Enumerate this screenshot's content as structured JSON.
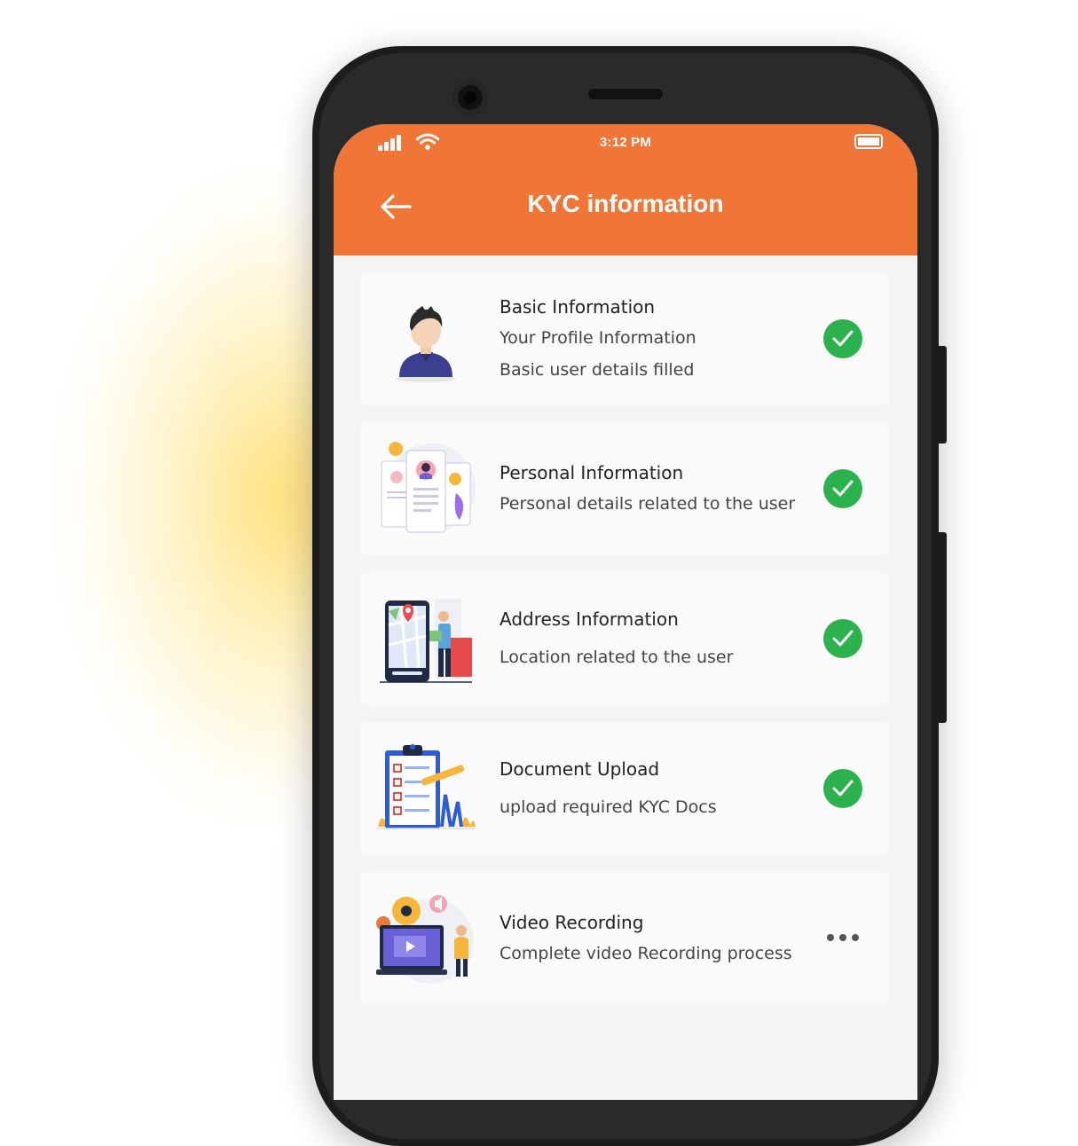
{
  "status_bar": {
    "time": "3:12 PM"
  },
  "header": {
    "title": "KYC information"
  },
  "items": [
    {
      "title": "Basic Information",
      "subtitle": "Your Profile Information\nBasic user details filled",
      "status": "complete",
      "icon": "person-avatar-icon"
    },
    {
      "title": "Personal Information",
      "subtitle": "Personal details related to the user",
      "status": "complete",
      "icon": "profile-cards-icon"
    },
    {
      "title": "Address Information",
      "subtitle": "Location related to the user",
      "status": "complete",
      "icon": "map-location-icon"
    },
    {
      "title": "Document Upload",
      "subtitle": "upload required KYC Docs",
      "status": "complete",
      "icon": "clipboard-checklist-icon"
    },
    {
      "title": "Video Recording",
      "subtitle": "Complete video Recording process",
      "status": "pending",
      "icon": "video-recording-icon"
    }
  ],
  "colors": {
    "accent": "#f07637",
    "success": "#2bb24c",
    "card": "#fafafa",
    "background": "#f4f4f4"
  }
}
